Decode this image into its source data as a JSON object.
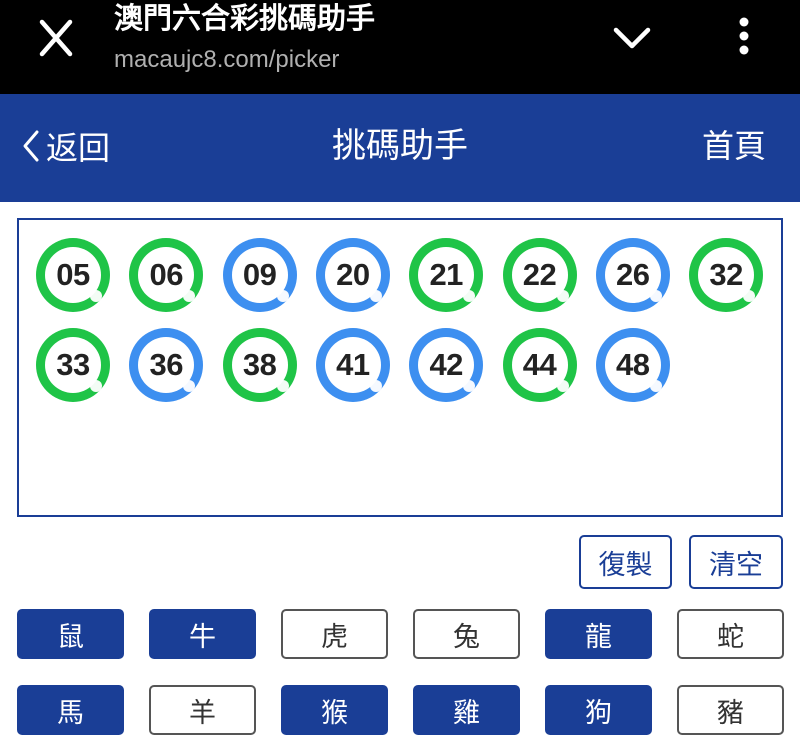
{
  "browser": {
    "title": "澳門六合彩挑碼助手",
    "url": "macaujc8.com/picker"
  },
  "header": {
    "back_label": "返回",
    "title": "挑碼助手",
    "home_label": "首頁"
  },
  "picked_numbers": [
    {
      "num": "05",
      "color": "green"
    },
    {
      "num": "06",
      "color": "green"
    },
    {
      "num": "09",
      "color": "blue"
    },
    {
      "num": "20",
      "color": "blue"
    },
    {
      "num": "21",
      "color": "green"
    },
    {
      "num": "22",
      "color": "green"
    },
    {
      "num": "26",
      "color": "blue"
    },
    {
      "num": "32",
      "color": "green"
    },
    {
      "num": "33",
      "color": "green"
    },
    {
      "num": "36",
      "color": "blue"
    },
    {
      "num": "38",
      "color": "green"
    },
    {
      "num": "41",
      "color": "blue"
    },
    {
      "num": "42",
      "color": "blue"
    },
    {
      "num": "44",
      "color": "green"
    },
    {
      "num": "48",
      "color": "blue"
    }
  ],
  "actions": {
    "copy_label": "復製",
    "clear_label": "清空"
  },
  "zodiac": [
    {
      "label": "鼠",
      "selected": true
    },
    {
      "label": "牛",
      "selected": true
    },
    {
      "label": "虎",
      "selected": false
    },
    {
      "label": "兔",
      "selected": false
    },
    {
      "label": "龍",
      "selected": true
    },
    {
      "label": "蛇",
      "selected": false
    },
    {
      "label": "馬",
      "selected": true
    },
    {
      "label": "羊",
      "selected": false
    },
    {
      "label": "猴",
      "selected": true
    },
    {
      "label": "雞",
      "selected": true
    },
    {
      "label": "狗",
      "selected": true
    },
    {
      "label": "豬",
      "selected": false
    }
  ],
  "colors": {
    "brand_blue": "#1a3e96",
    "ball_green": "#1fc447",
    "ball_blue": "#3d8ff0"
  }
}
